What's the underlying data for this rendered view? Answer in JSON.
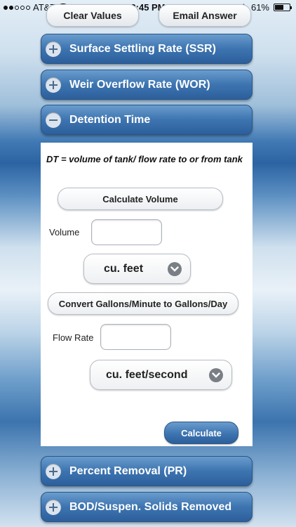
{
  "status_bar": {
    "carrier": "AT&T",
    "time": "3:45 PM",
    "battery": "61%",
    "battery_level": 0.61
  },
  "top_buttons": {
    "clear": "Clear Values",
    "email": "Email Answer"
  },
  "sections": [
    {
      "label": "Surface Settling Rate (SSR)",
      "state": "collapsed"
    },
    {
      "label": "Weir Overflow Rate (WOR)",
      "state": "collapsed"
    },
    {
      "label": "Detention Time",
      "state": "expanded"
    },
    {
      "label": "Percent Removal (PR)",
      "state": "collapsed"
    },
    {
      "label": "BOD/Suspen. Solids Removed",
      "state": "collapsed"
    }
  ],
  "detention": {
    "formula": "DT = volume of tank/ flow rate to or from tank",
    "calc_volume_button": "Calculate Volume",
    "volume_label": "Volume",
    "volume_value": "",
    "volume_unit": "cu. feet",
    "convert_button": "Convert Gallons/Minute to Gallons/Day",
    "flow_label": "Flow Rate",
    "flow_value": "",
    "flow_unit": "cu. feet/second",
    "calculate_button": "Calculate"
  }
}
